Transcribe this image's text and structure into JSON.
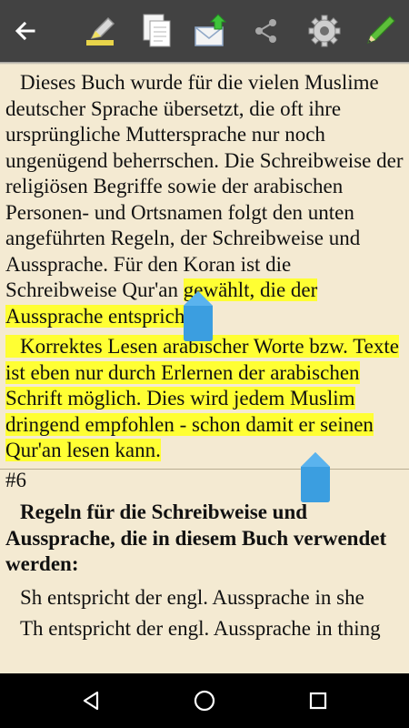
{
  "toolbar": {
    "back_icon": "arrow-left-icon",
    "icons": [
      "highlighter-icon",
      "copy-icon",
      "share-email-icon",
      "share-icon",
      "settings-gear-icon",
      "edit-pencil-icon"
    ]
  },
  "content": {
    "p1_plain": "Dieses Buch wurde für die vielen Muslime deutscher Sprache übersetzt, die oft ihre ursprüngliche Muttersprache nur noch ungenügend beherrschen. Die Schreibweise der religiösen Begriffe sowie der arabischen Personen- und Ortsnamen folgt den unten angeführten Regeln, der Schreibweise und Aussprache. Für den Koran ist die Schreibweise Qur'an ",
    "p1_highlight": "gewählt, die der Aussprache entspricht.",
    "p2_highlight": "Korrektes Lesen arabischer Worte bzw. Texte ist eben nur durch Erlernen der arabischen Schrift möglich. Dies wird jedem Muslim dringend empfohlen - schon damit er seinen Qur'an lesen kann.",
    "section_number": "#6",
    "heading": "Regeln für die Schreibweise und Aussprache, die in diesem Buch verwendet werden:",
    "rule1": "Sh entspricht der engl. Aussprache in she",
    "rule2": "Th entspricht der engl. Aussprache in thing"
  },
  "colors": {
    "toolbar": "#424242",
    "page": "#f4ead2",
    "highlight": "#ffff33",
    "handle": "#3b9ee0"
  },
  "navbar": {
    "icons": [
      "nav-back-icon",
      "nav-home-icon",
      "nav-recents-icon"
    ]
  }
}
